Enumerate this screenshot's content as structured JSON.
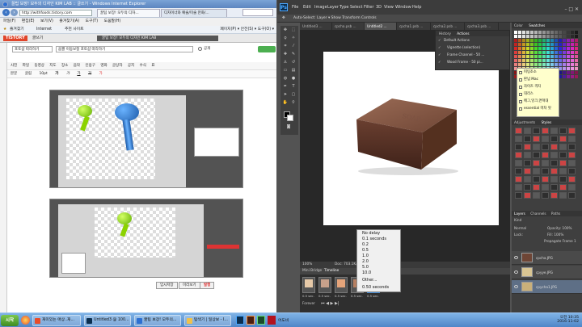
{
  "ie": {
    "title": "꿀팁 보장! 모두의 디자인 KIM LAB :: 글쓰기 - Windows Internet Explorer",
    "url": "http://withfoods.tistory.com",
    "tabs": [
      "꿀팁 보장! 모두의 디자...",
      "디자이너와 예술/미술 만화/..."
    ],
    "menu": [
      "파일(F)",
      "편집(E)",
      "보기(V)",
      "즐겨찾기(A)",
      "도구(T)",
      "도움말(H)"
    ],
    "favorites": "즐겨찾기",
    "fav_items": [
      "Internet",
      "추천 사이트"
    ],
    "fav_right": "페이지(P) ▾  안전(S) ▾  도구(O) ▾",
    "tistory_logo": "TISTORY",
    "blog_label": "글쓰기",
    "blog_header": "꿀팁 보장! 모두의 디자인 KIM LAB",
    "category": "포토샵 따라하기",
    "post_title": "움짤 이동보정 포토샵 따라하기",
    "privacy": "공개",
    "toolbar": [
      "사진",
      "파일",
      "동영상",
      "지도",
      "장소",
      "음악",
      "인용구",
      "영화",
      "글상자",
      "공지",
      "수식",
      "표"
    ],
    "toolbar2": [
      "본문",
      "굴림",
      "10pt",
      "가",
      "가",
      "가",
      "가",
      "가"
    ],
    "btn_temp": "임시저장",
    "btn_preview": "미리보기",
    "btn_publish": "발행"
  },
  "ps": {
    "logo": "Ps",
    "menu": [
      "File",
      "Edit",
      "Image",
      "Layer",
      "Type",
      "Select",
      "Filter",
      "3D",
      "View",
      "Window",
      "Help"
    ],
    "options": "Auto-Select:  Layer ▾    Show Transform Controls",
    "doc_tabs": [
      "Untitled3 ...",
      "cpcha.psb ...",
      "Untitled2 ...",
      "cpcha1.psb ...",
      "cpcha2.psb ...",
      "cpcha3.psb ..."
    ],
    "zoom": "100%",
    "doc_info": "Doc: 703.1K/1.28M",
    "timeline_tabs": [
      "Mini Bridge",
      "Timeline"
    ],
    "frame_delay": "0.5 sec.",
    "loop": "Forever",
    "delay_menu": [
      "No delay",
      "0.1 seconds",
      "0.2",
      "0.5",
      "1.0",
      "2.0",
      "5.0",
      "10.0",
      "Other...",
      "0.50 seconds"
    ],
    "actions_title": "Actions",
    "history_title": "History",
    "actions": [
      "Default Actions",
      "Vignette (selection)",
      "Frame Channel - 50 ...",
      "Wood Frame - 50 pi..."
    ],
    "color_tab": "Color",
    "swatches_tab": "Swatches",
    "adjustments_tab": "Adjustments",
    "styles_tab": "Styles",
    "layers_tab": "Layers",
    "channels_tab": "Channels",
    "paths_tab": "Paths",
    "kind": "Kind",
    "normal": "Normal",
    "opacity": "Opacity: 100%",
    "lock": "Lock:",
    "fill": "Fill: 100%",
    "propagate": "Propagate Frame 1",
    "layers": [
      "cpcha.JPG",
      "cpyye.JPG",
      "cpycha1.JPG"
    ]
  },
  "note": [
    "피팅조소",
    "판넘 Mac",
    "자이즈 격자",
    "대리스",
    "메그,잉크,면혁대",
    "essential 마차 핏"
  ],
  "taskbar": {
    "start": "시작",
    "items": [
      "재미있는 애상..재...",
      "Untitled3 @ 100...",
      "꿀팁 보장! 모두의...",
      "탐색기 | 일상보 - I...",
      "어도비"
    ],
    "time": "오전 10:35",
    "date": "2016-11-02"
  },
  "colors": {
    "ps_bg": "#535353",
    "ps_dark": "#282828",
    "ie_bg": "#f3f3f3",
    "tistory": "#e0452b",
    "publish": "#d33"
  }
}
